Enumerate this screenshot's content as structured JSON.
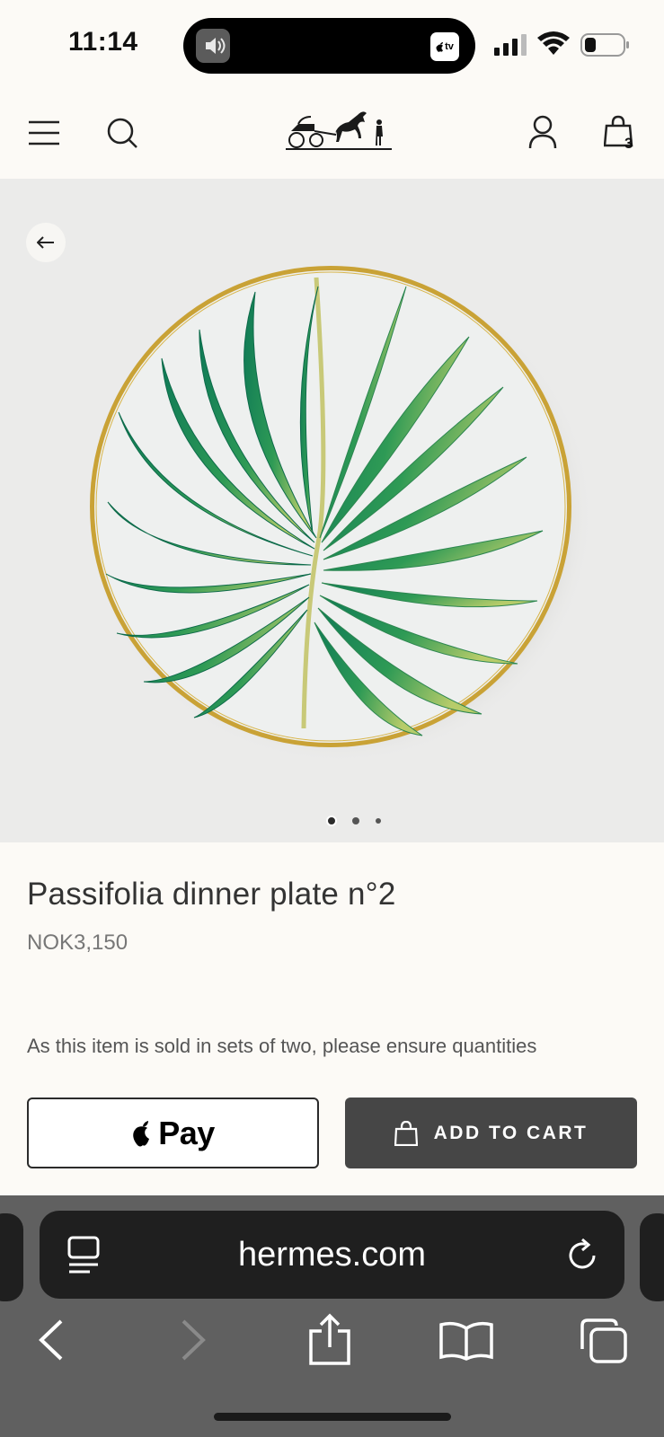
{
  "status_bar": {
    "time": "11:14",
    "island_tv_label": "tv",
    "icons": [
      "speaker-icon",
      "apple-tv-icon",
      "cellular-signal-icon",
      "wifi-icon",
      "battery-icon"
    ]
  },
  "header": {
    "icons": [
      "menu-icon",
      "search-icon",
      "hermes-logo",
      "account-icon",
      "shopping-bag-icon"
    ],
    "cart_count": "3"
  },
  "gallery": {
    "image_subject": "plate-image",
    "pages_total": 3,
    "active_page": 1
  },
  "product": {
    "title": "Passifolia dinner plate n°2",
    "price": "NOK3,150",
    "note": "As this item is sold in sets of two, please ensure quantities"
  },
  "actions": {
    "apple_pay_label": "Pay",
    "add_to_cart_label": "ADD TO CART"
  },
  "browser": {
    "url": "hermes.com",
    "icons": [
      "reader-icon",
      "reload-icon",
      "back-arrow-icon",
      "forward-arrow-icon",
      "share-icon",
      "bookmarks-icon",
      "tabs-icon"
    ]
  },
  "colors": {
    "page_background": "#fcfaf6",
    "image_background": "#ebebea",
    "add_to_cart_background": "#464646",
    "browser_toolbar": "#606060",
    "address_bar": "#1f1f1f",
    "plate_rim_gold": "#c9a236",
    "leaf_green": "#1f8a5a"
  }
}
